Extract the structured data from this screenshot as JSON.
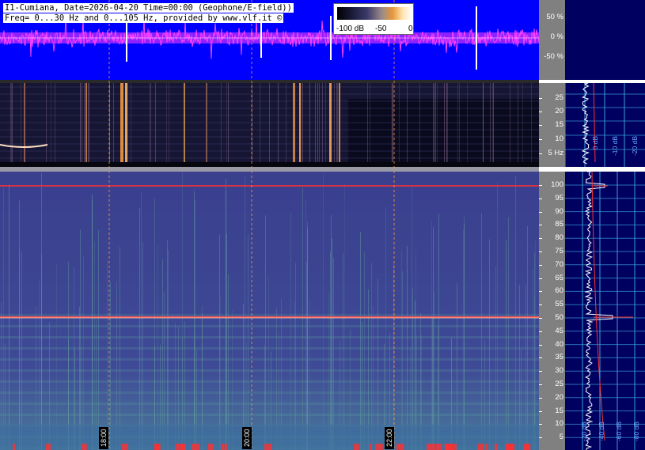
{
  "header": {
    "title_line": "I1-Cumiana, Date=2026-04-20 Time=00:00 (Geophone/E-field))",
    "freq_line": "Freq= 0...30 Hz and 0...105 Hz, provided by www.vlf.it ©"
  },
  "legend": {
    "labels": [
      "-100 dB",
      "-50",
      "0"
    ]
  },
  "top_axis": {
    "ticks": [
      "50 %",
      "0 %",
      "-50 %"
    ]
  },
  "mid_axis": {
    "ticks": [
      "25",
      "20",
      "15",
      "10",
      "5 Hz"
    ]
  },
  "bottom_axis": {
    "ticks": [
      "100",
      "95",
      "90",
      "85",
      "80",
      "75",
      "70",
      "65",
      "60",
      "55",
      "50",
      "45",
      "40",
      "35",
      "30",
      "25",
      "20",
      "15",
      "10",
      "5"
    ]
  },
  "time_labels": [
    "18:00",
    "20:00",
    "22:00"
  ],
  "mid_side_labels": [
    "0 dB",
    "-10 dB",
    "-20 dB"
  ],
  "bottom_side_labels": [
    "-20 dB",
    "-40 dB",
    "-60 dB",
    "-80 dB"
  ],
  "colors": {
    "waveform_bg": "#0000ff",
    "waveform_trace": "#ff40ff",
    "spectrogram_dark": "#12122e",
    "spectrogram_bottom": "#3c4a9a",
    "side_bg": "#000060",
    "axis_bg": "#808080",
    "grid_cyan": "#3aa0d8",
    "marker_red": "#ff2020"
  }
}
